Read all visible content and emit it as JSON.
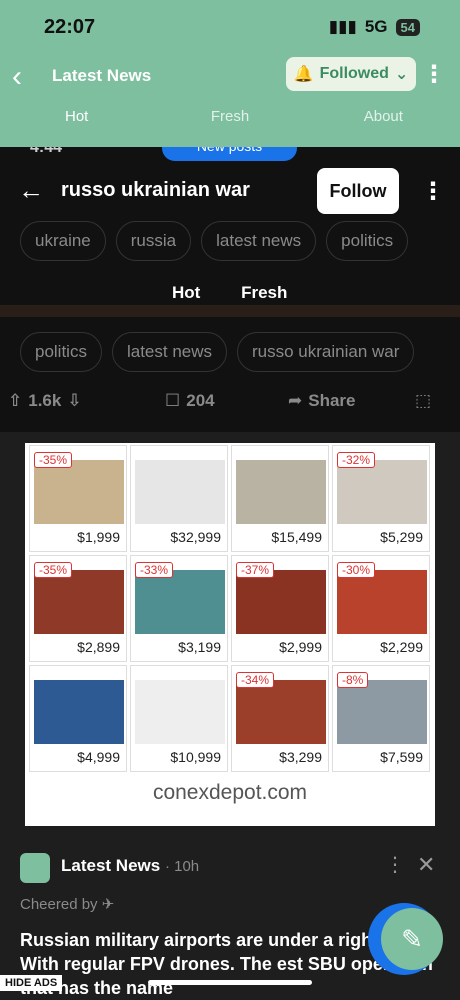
{
  "status": {
    "time": "22:07",
    "network": "5G",
    "battery": "54"
  },
  "appbar": {
    "title": "Latest News",
    "followed_label": "Followed",
    "tabs": [
      "Hot",
      "Fresh",
      "About"
    ]
  },
  "inner": {
    "time": "4:44",
    "new_posts": "New posts",
    "title": "russo ukrainian war",
    "follow_label": "Follow",
    "chips_top": [
      "ukraine",
      "russia",
      "latest news",
      "politics"
    ],
    "feed_tabs": [
      "Hot",
      "Fresh"
    ],
    "chips_bottom": [
      "politics",
      "latest news",
      "russo ukrainian war"
    ],
    "upvotes": "1.6k",
    "comments": "204",
    "share": "Share"
  },
  "ad": {
    "domain": "conexdepot.com",
    "items": [
      {
        "disc": "-35%",
        "price": "$1,999",
        "color": "#c8b38e"
      },
      {
        "disc": "",
        "price": "$32,999",
        "color": "#e6e6e6"
      },
      {
        "disc": "",
        "price": "$15,499",
        "color": "#b8b3a2"
      },
      {
        "disc": "-32%",
        "price": "$5,299",
        "color": "#cfc9c0"
      },
      {
        "disc": "-35%",
        "price": "$2,899",
        "color": "#8f3a28"
      },
      {
        "disc": "-33%",
        "price": "$3,199",
        "color": "#4f8f92"
      },
      {
        "disc": "-37%",
        "price": "$2,999",
        "color": "#8b3323"
      },
      {
        "disc": "-30%",
        "price": "$2,299",
        "color": "#b8422c"
      },
      {
        "disc": "",
        "price": "$4,999",
        "color": "#2e5a93"
      },
      {
        "disc": "",
        "price": "$10,999",
        "color": "#eeeeee"
      },
      {
        "disc": "-34%",
        "price": "$3,299",
        "color": "#9b3e2a"
      },
      {
        "disc": "-8%",
        "price": "$7,599",
        "color": "#8e9aa3"
      }
    ]
  },
  "post": {
    "source": "Latest News",
    "age": "· 10h",
    "cheered": "Cheered by",
    "text": "Russian military airports are under a right now. With regular FPV drones. The est SBU operation that has the name"
  },
  "hide_ads": "HIDE ADS"
}
